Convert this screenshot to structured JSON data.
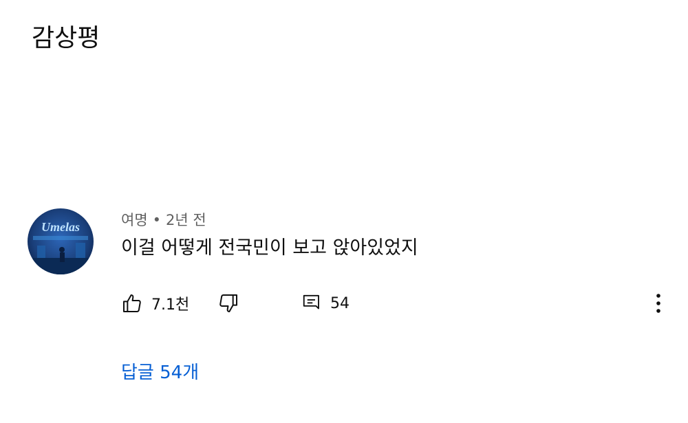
{
  "section": {
    "title": "감상평"
  },
  "comment": {
    "avatar_text": "Umelas",
    "author": "여명",
    "separator": "•",
    "time": "2년 전",
    "text": "이걸 어떻게 전국민이 보고 앉아있었지",
    "likes": "7.1천",
    "reply_count": "54",
    "replies_link": "답글 54개"
  },
  "icons": {
    "like": "thumbs-up-icon",
    "dislike": "thumbs-down-icon",
    "reply": "comment-icon",
    "more": "more-vertical-icon"
  },
  "colors": {
    "link": "#065fd4",
    "meta": "#606060",
    "text": "#0f0f0f",
    "avatar_bg": "#1a3f7a"
  }
}
